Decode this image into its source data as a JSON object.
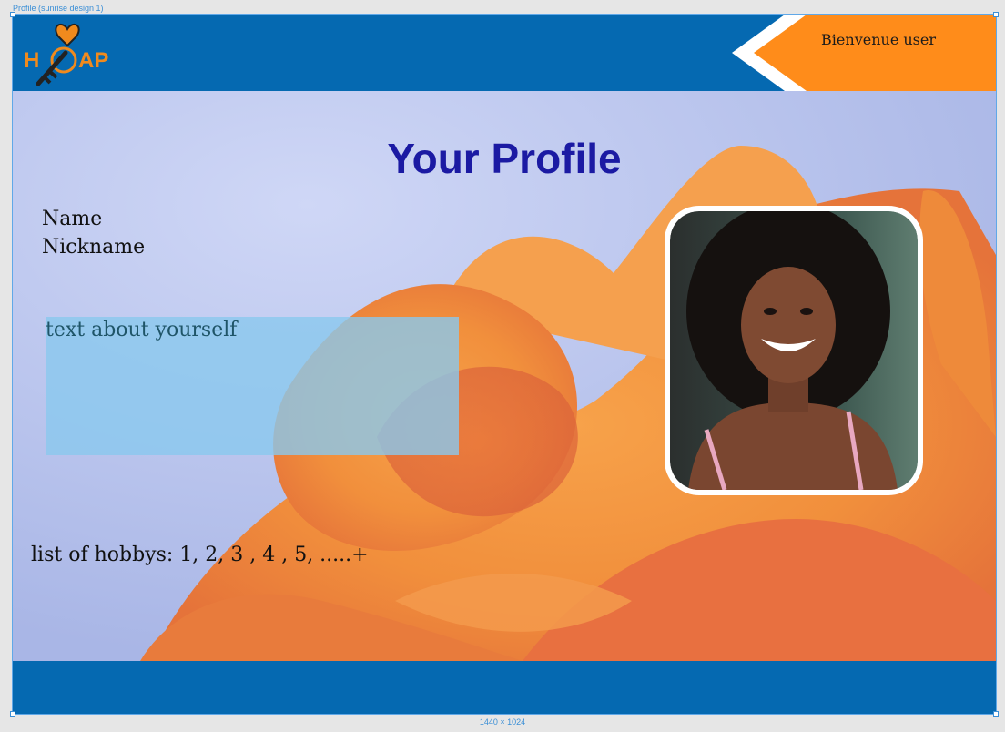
{
  "frame": {
    "label": "Profile (sunrise design 1)",
    "size": "1440 × 1024"
  },
  "header": {
    "logo_alt": "HOAP",
    "welcome": "Bienvenue user",
    "accent": "#ff8c1a",
    "brand": "#0569b1"
  },
  "main": {
    "title": "Your Profile",
    "name_label": "Name",
    "nickname_label": "Nickname",
    "about_placeholder": "text about yourself",
    "hobbies": "list of hobbys: 1, 2, 3 , 4 , 5, .....+"
  },
  "icons": {
    "logo": "hoap-key-logo-icon",
    "photo": "profile-photo"
  }
}
